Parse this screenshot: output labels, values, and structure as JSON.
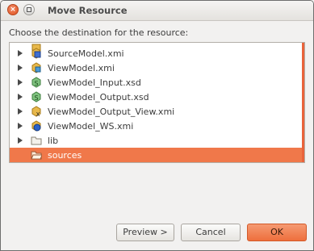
{
  "window": {
    "title": "Move Resource",
    "close_glyph": "×"
  },
  "prompt": "Choose the destination for the resource:",
  "tree": {
    "items": [
      {
        "label": "SourceModel.xmi",
        "icon": "model-xmi-icon",
        "expandable": true
      },
      {
        "label": "ViewModel.xmi",
        "icon": "model-xmi-icon",
        "expandable": true
      },
      {
        "label": "ViewModel_Input.xsd",
        "icon": "schema-xsd-icon",
        "expandable": true
      },
      {
        "label": "ViewModel_Output.xsd",
        "icon": "schema-xsd-icon",
        "expandable": true
      },
      {
        "label": "ViewModel_Output_View.xmi",
        "icon": "model-xmi-icon",
        "expandable": true
      },
      {
        "label": "ViewModel_WS.xmi",
        "icon": "webservice-model-icon",
        "expandable": true
      },
      {
        "label": "lib",
        "icon": "folder-icon",
        "expandable": true
      },
      {
        "label": "sources",
        "icon": "folder-open-icon",
        "expandable": false,
        "selected": true
      }
    ]
  },
  "buttons": {
    "preview": "Preview >",
    "cancel": "Cancel",
    "ok": "OK"
  },
  "colors": {
    "accent": "#f0784a",
    "selection": "#f0784a"
  }
}
